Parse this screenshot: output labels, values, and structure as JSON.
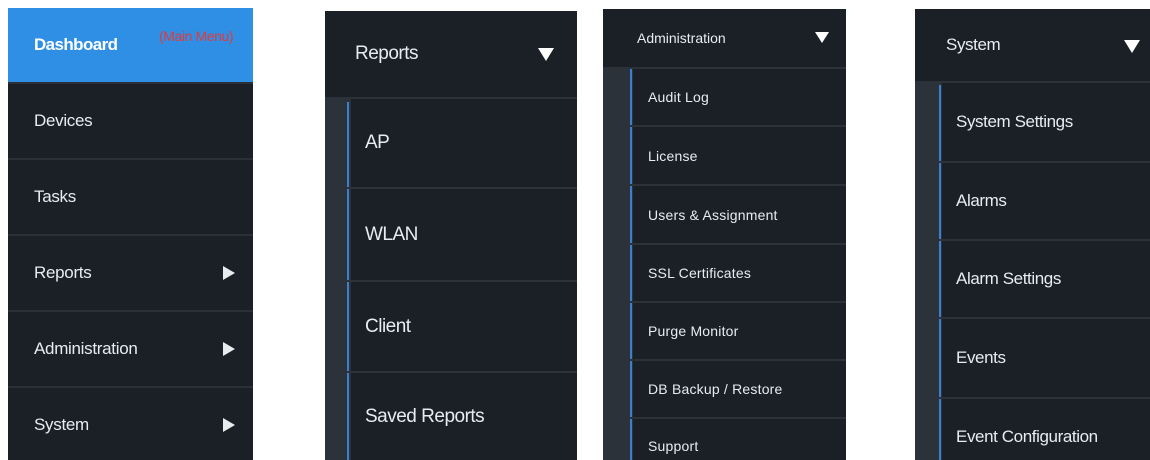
{
  "main_menu": {
    "annotation": "(Main Menu)",
    "items": [
      {
        "label": "Dashboard",
        "active": true,
        "has_submenu": false
      },
      {
        "label": "Devices",
        "active": false,
        "has_submenu": false
      },
      {
        "label": "Tasks",
        "active": false,
        "has_submenu": false
      },
      {
        "label": "Reports",
        "active": false,
        "has_submenu": true
      },
      {
        "label": "Administration",
        "active": false,
        "has_submenu": true
      },
      {
        "label": "System",
        "active": false,
        "has_submenu": true
      }
    ]
  },
  "reports_menu": {
    "title": "Reports",
    "items": [
      "AP",
      "WLAN",
      "Client",
      "Saved Reports"
    ]
  },
  "administration_menu": {
    "title": "Administration",
    "items": [
      "Audit Log",
      "License",
      "Users & Assignment",
      "SSL Certificates",
      "Purge Monitor",
      "DB Backup / Restore",
      "Support"
    ]
  },
  "system_menu": {
    "title": "System",
    "items": [
      "System Settings",
      "Alarms",
      "Alarm Settings",
      "Events",
      "Event Configuration"
    ]
  },
  "colors": {
    "panel_bg": "#1b1f26",
    "active_bg": "#2f8fe5",
    "accent": "#3a7fd0",
    "annotation": "#e23a3a",
    "gutter": "#2c3239"
  },
  "icons": {
    "submenu_indicator": "triangle-right-icon",
    "expanded_indicator": "triangle-down-icon"
  }
}
